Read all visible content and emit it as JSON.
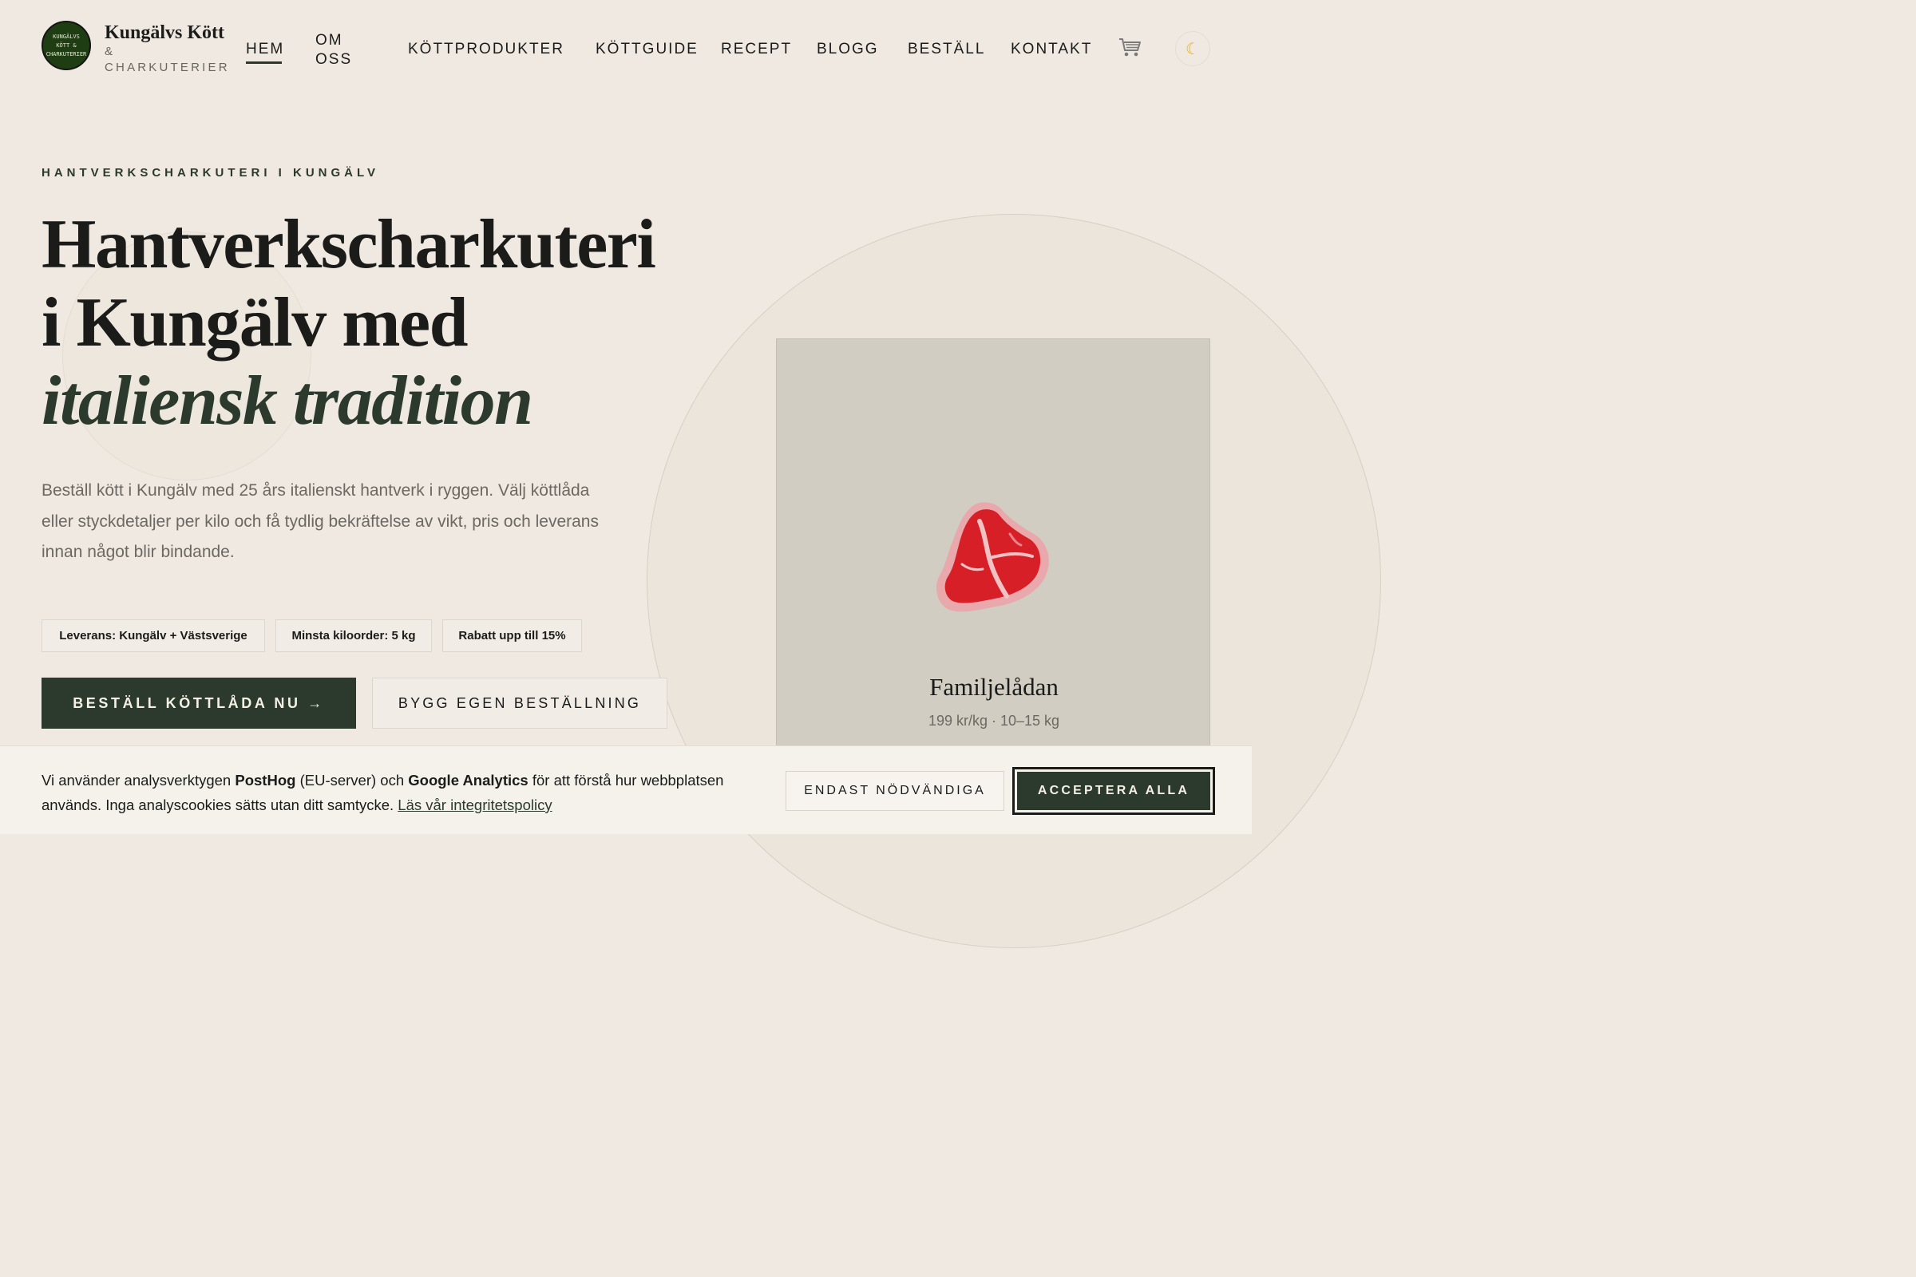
{
  "brand": {
    "badge_line1": "KUNGÄLVS",
    "badge_line2": "KÖTT &",
    "badge_line3": "CHARKUTERIER",
    "name": "Kungälvs Kött",
    "amp": "&",
    "sub": "CHARKUTERIER"
  },
  "nav": {
    "hem": "HEM",
    "om_line1": "OM",
    "om_line2": "OSS",
    "kottprodukter": "KÖTTPRODUKTER",
    "kottguide": "KÖTTGUIDE",
    "recept": "RECEPT",
    "blogg": "BLOGG",
    "bestall": "BESTÄLL",
    "kontakt": "KONTAKT",
    "cart_icon": "cart-icon",
    "theme_icon": "moon-icon"
  },
  "hero": {
    "eyebrow": "HANTVERKSCHARKUTERI I KUNGÄLV",
    "headline_line1": "Hantverkscharkuteri",
    "headline_line2": "i Kungälv med",
    "headline_italic": "italiensk tradition",
    "lead": "Beställ kött i Kungälv med 25 års italienskt hantverk i ryggen. Välj köttlåda eller styckdetaljer per kilo och få tydlig bekräftelse av vikt, pris och leverans innan något blir bindande.",
    "chips": [
      "Leverans: Kungälv + Västsverige",
      "Minsta kiloorder: 5 kg",
      "Rabatt upp till 15%"
    ],
    "primary_cta": "BESTÄLL KÖTTLÅDA NU →",
    "secondary_cta": "BYGG EGEN BESTÄLLNING"
  },
  "card": {
    "title": "Familjelådan",
    "meta": "199 kr/kg · 10–15 kg",
    "icon": "steak-icon"
  },
  "cookie": {
    "text_part1": "Vi använder analysverktygen ",
    "posthog": "PostHog",
    "text_part2": " (EU-server) och ",
    "ga": "Google Analytics",
    "text_part3": " för att förstå hur webbplatsen används. Inga analyscookies sätts utan ditt samtycke. ",
    "link": "Läs vår integritetspolicy",
    "necessary_btn": "ENDAST NÖDVÄNDIGA",
    "accept_btn": "ACCEPTERA ALLA"
  },
  "colors": {
    "background": "#efe9e1",
    "accent_green": "#2b3a2c",
    "card_bg": "#d1cdc2",
    "muted_text": "#6d6862"
  }
}
